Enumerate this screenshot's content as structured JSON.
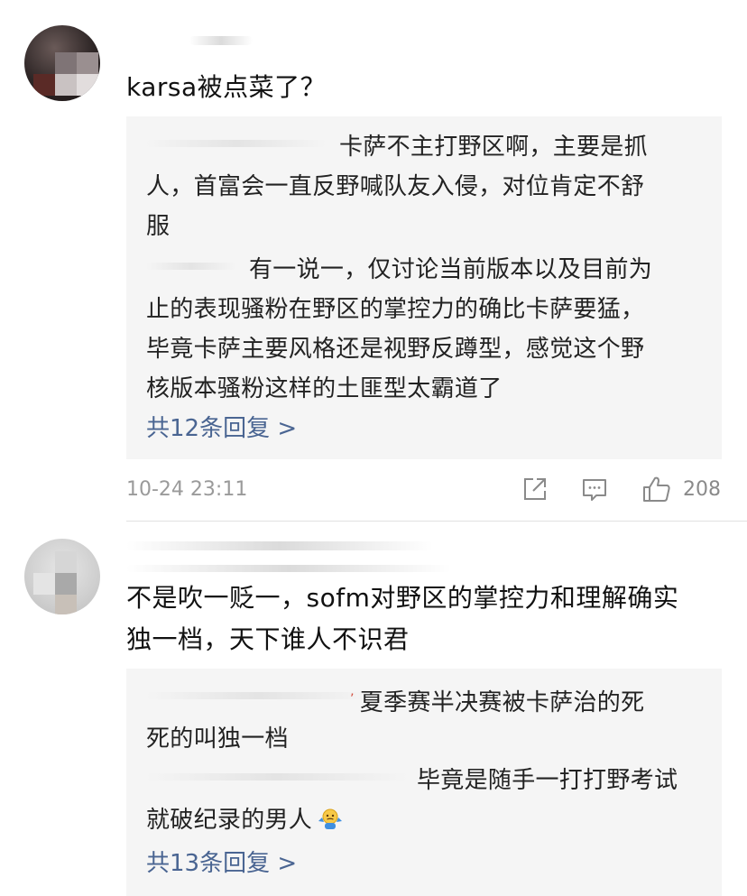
{
  "comments": [
    {
      "text_lines": [
        "karsa被点菜了？"
      ],
      "replies": [
        {
          "lines": [
            "卡萨不主打野区啊，主要是抓",
            "人，首富会一直反野喊队友入侵，对位肯定不舒",
            "服"
          ]
        },
        {
          "lines": [
            "有一说一，仅讨论当前版本以及目前为",
            "止的表现骚粉在野区的掌控力的确比卡萨要猛，",
            "毕竟卡萨主要风格还是视野反蹲型，感觉这个野",
            "核版本骚粉这样的土匪型太霸道了"
          ]
        }
      ],
      "more_replies": "共12条回复 >",
      "time": "10-24 23:11",
      "like_count": "208"
    },
    {
      "text_lines": [
        "不是吹一贬一，sofm对野区的掌控力和理解确实",
        "独一档，天下谁人不识君"
      ],
      "replies": [
        {
          "lines": [
            "夏季赛半决赛被卡萨治的死",
            "死的叫独一档"
          ]
        },
        {
          "lines": [
            "毕竟是随手一打打野考试",
            "就破纪录的男人"
          ],
          "emoji": "shrug-emoji"
        }
      ],
      "more_replies": "共13条回复 >"
    }
  ],
  "icons": {
    "share": "share-icon",
    "comment": "comment-icon",
    "like": "thumbs-up-icon"
  },
  "colors": {
    "link": "#4a6592",
    "reply_bg": "#f5f5f5",
    "meta": "#9a9a9a"
  }
}
